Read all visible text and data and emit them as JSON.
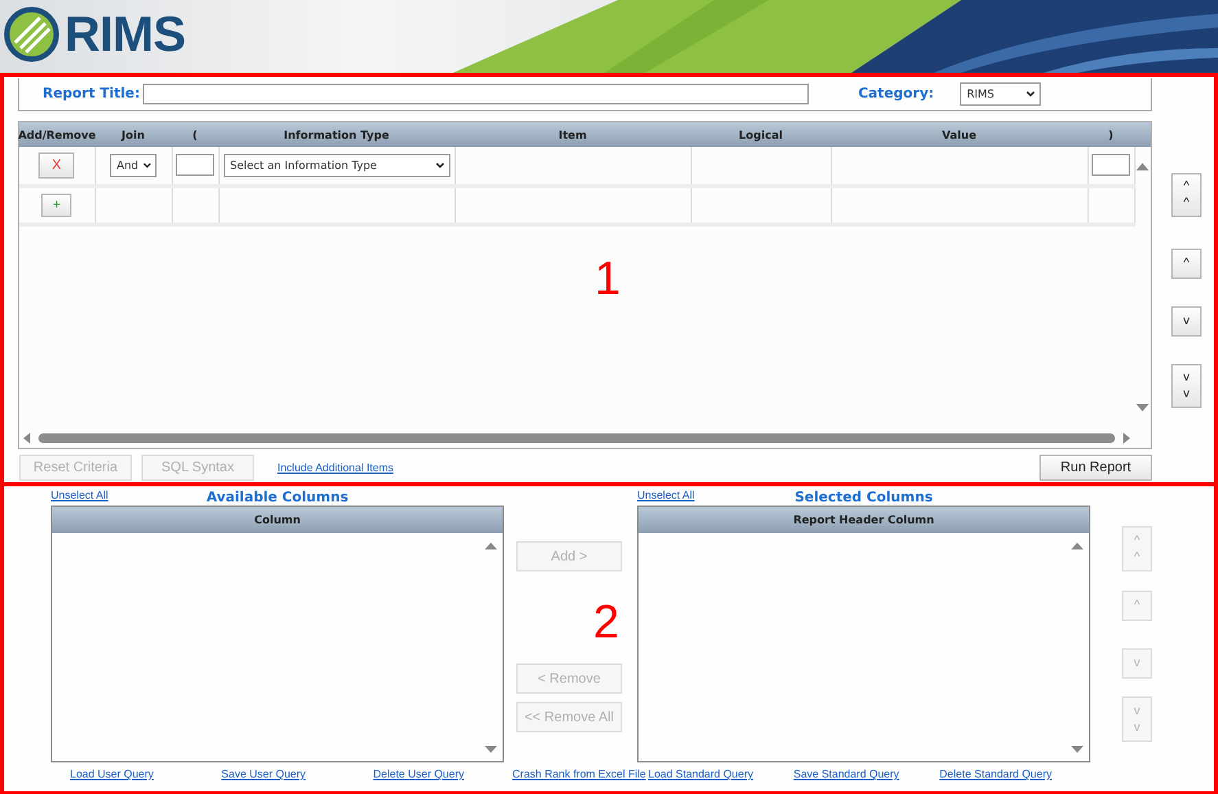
{
  "header": {
    "logo_text": "RIMS"
  },
  "criteria_section": {
    "annotation": "1",
    "report_title": {
      "label": "Report Title:"
    },
    "category": {
      "label": "Category:",
      "value": "RIMS"
    },
    "grid": {
      "columns": [
        "Add/Remove",
        "Join",
        "(",
        "Information Type",
        "Item",
        "Logical",
        "Value",
        ")"
      ],
      "rows": [
        {
          "kind": "criteria",
          "remove_button": "X",
          "join": "And",
          "information_type": "Select an Information Type"
        },
        {
          "kind": "add",
          "add_button": "+"
        }
      ]
    },
    "order_buttons": [
      {
        "label": "^\n^",
        "disabled": false
      },
      {
        "label": "^",
        "disabled": false
      },
      {
        "label": "v",
        "disabled": false
      },
      {
        "label": "v\nv",
        "disabled": false
      }
    ],
    "actions": [
      {
        "kind": "button",
        "label": "Reset Criteria",
        "disabled": true
      },
      {
        "kind": "button",
        "label": "SQL Syntax",
        "disabled": true
      },
      {
        "kind": "link",
        "label": "Include Additional Items"
      },
      {
        "kind": "button",
        "label": "Run Report",
        "disabled": false
      }
    ]
  },
  "columns_section": {
    "annotation": "2",
    "available": {
      "unselect_link": "Unselect All",
      "title": "Available Columns",
      "column_header": "Column"
    },
    "transfer_buttons": [
      {
        "label": "Add >",
        "disabled": true
      },
      {
        "label": "< Remove",
        "disabled": true
      },
      {
        "label": "<< Remove All",
        "disabled": true
      }
    ],
    "selected": {
      "unselect_link": "Unselect All",
      "title": "Selected Columns",
      "column_header": "Report Header Column"
    },
    "order_buttons": [
      {
        "label": "^\n^",
        "disabled": true
      },
      {
        "label": "^",
        "disabled": true
      },
      {
        "label": "v",
        "disabled": true
      },
      {
        "label": "v\nv",
        "disabled": true
      }
    ],
    "links": [
      "Load User Query",
      "Save User Query",
      "Delete User Query",
      "Crash Rank from Excel File",
      "Load Standard Query",
      "Save Standard Query",
      "Delete Standard Query"
    ]
  }
}
